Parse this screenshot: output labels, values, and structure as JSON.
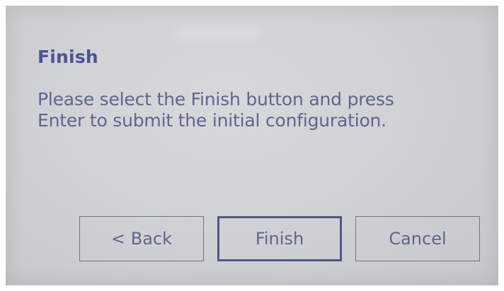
{
  "dialog": {
    "title": "Finish",
    "message": "Please select the Finish button and press Enter to submit the initial configuration."
  },
  "buttons": {
    "back": "< Back",
    "finish": "Finish",
    "cancel": "Cancel"
  },
  "colors": {
    "title": "#4a5498",
    "text": "#5f6591",
    "border": "#6d7396",
    "screen_background": "#cfd0d3"
  }
}
